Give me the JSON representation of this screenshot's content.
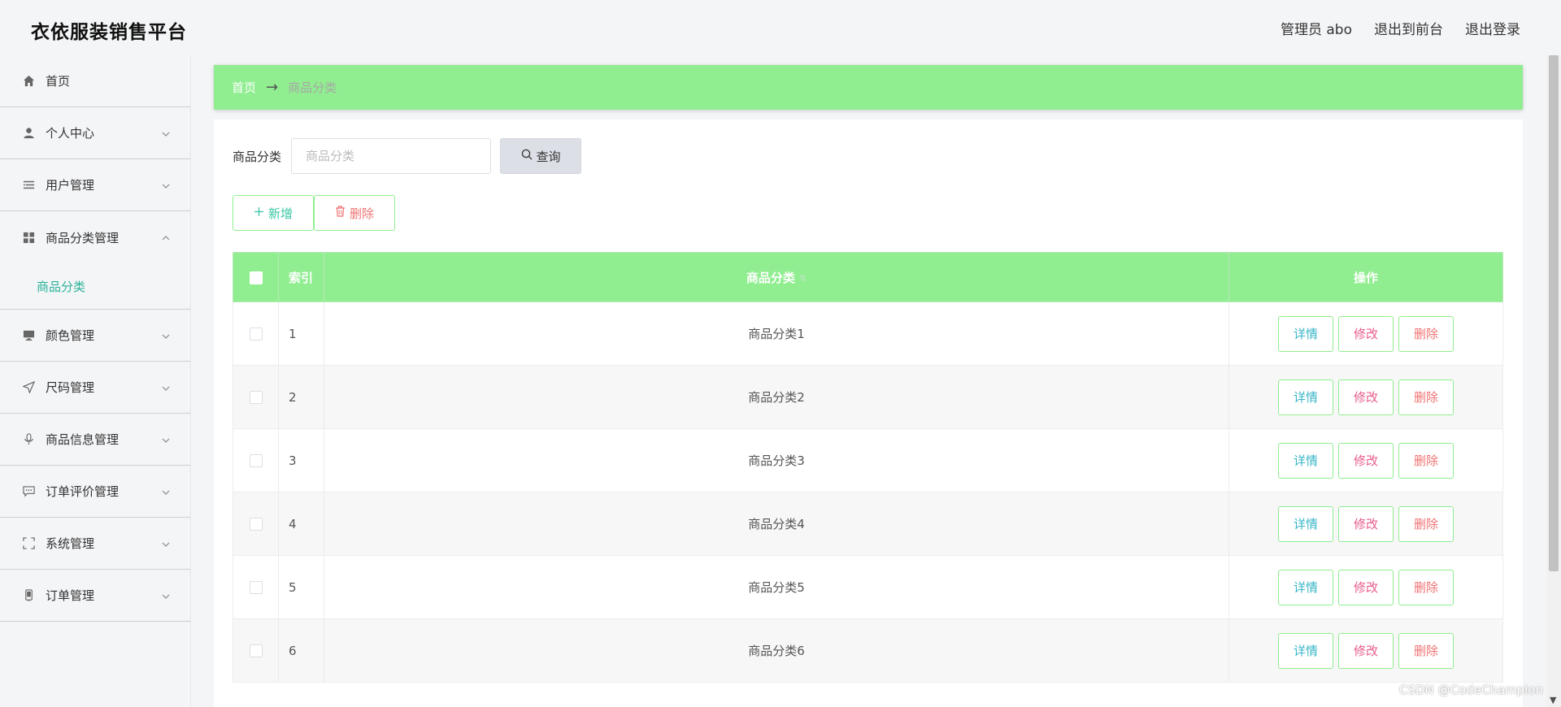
{
  "header": {
    "brand": "衣依服装销售平台",
    "admin": "管理员 abo",
    "back_front": "退出到前台",
    "logout": "退出登录"
  },
  "sidebar": {
    "items": [
      {
        "label": "首页",
        "icon": "home-icon"
      },
      {
        "label": "个人中心",
        "icon": "user-icon"
      },
      {
        "label": "用户管理",
        "icon": "list-icon"
      },
      {
        "label": "商品分类管理",
        "icon": "grid-icon",
        "expanded": true,
        "children": [
          {
            "label": "商品分类",
            "active": true
          }
        ]
      },
      {
        "label": "颜色管理",
        "icon": "monitor-icon"
      },
      {
        "label": "尺码管理",
        "icon": "send-icon"
      },
      {
        "label": "商品信息管理",
        "icon": "microphone-icon"
      },
      {
        "label": "订单评价管理",
        "icon": "chat-icon"
      },
      {
        "label": "系统管理",
        "icon": "fullscreen-icon"
      },
      {
        "label": "订单管理",
        "icon": "phone-icon"
      }
    ]
  },
  "breadcrumb": {
    "home": "首页",
    "separator": "→",
    "current": "商品分类"
  },
  "search": {
    "label": "商品分类",
    "placeholder": "商品分类",
    "value": "",
    "button": "查询"
  },
  "actions": {
    "add": "新增",
    "delete": "删除"
  },
  "table": {
    "headers": {
      "index": "索引",
      "name": "商品分类",
      "ops": "操作"
    },
    "rows": [
      {
        "index": "1",
        "name": "商品分类1"
      },
      {
        "index": "2",
        "name": "商品分类2"
      },
      {
        "index": "3",
        "name": "商品分类3"
      },
      {
        "index": "4",
        "name": "商品分类4"
      },
      {
        "index": "5",
        "name": "商品分类5"
      },
      {
        "index": "6",
        "name": "商品分类6"
      }
    ],
    "row_ops": {
      "detail": "详情",
      "edit": "修改",
      "remove": "删除"
    }
  },
  "watermark": "CSDN @CodeChampion",
  "colors": {
    "accent_green": "#90ee90",
    "detail": "#38b6c8",
    "edit": "#e95c8c",
    "remove": "#f07171",
    "active_sub": "#2bb39a"
  }
}
